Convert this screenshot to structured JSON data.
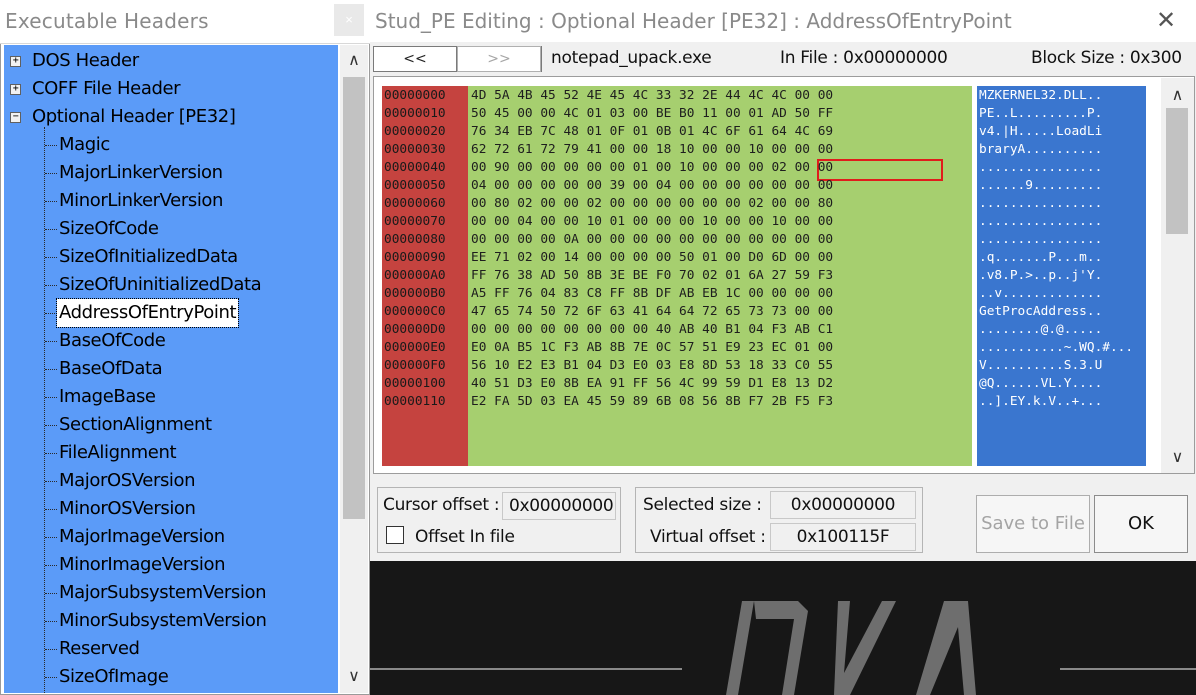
{
  "left_window": {
    "title": "Executable Headers",
    "close_label": "×",
    "tree": [
      {
        "label": "DOS Header",
        "level": 0,
        "expander": "+"
      },
      {
        "label": "COFF File Header",
        "level": 0,
        "expander": "+"
      },
      {
        "label": "Optional Header [PE32]",
        "level": 0,
        "expander": "−"
      },
      {
        "label": "Magic",
        "level": 1
      },
      {
        "label": "MajorLinkerVersion",
        "level": 1
      },
      {
        "label": "MinorLinkerVersion",
        "level": 1
      },
      {
        "label": "SizeOfCode",
        "level": 1
      },
      {
        "label": "SizeOfInitializedData",
        "level": 1
      },
      {
        "label": "SizeOfUninitializedData",
        "level": 1
      },
      {
        "label": "AddressOfEntryPoint",
        "level": 1,
        "selected": true
      },
      {
        "label": "BaseOfCode",
        "level": 1
      },
      {
        "label": "BaseOfData",
        "level": 1
      },
      {
        "label": "ImageBase",
        "level": 1
      },
      {
        "label": "SectionAlignment",
        "level": 1
      },
      {
        "label": "FileAlignment",
        "level": 1
      },
      {
        "label": "MajorOSVersion",
        "level": 1
      },
      {
        "label": "MinorOSVersion",
        "level": 1
      },
      {
        "label": "MajorImageVersion",
        "level": 1
      },
      {
        "label": "MinorImageVersion",
        "level": 1
      },
      {
        "label": "MajorSubsystemVersion",
        "level": 1
      },
      {
        "label": "MinorSubsystemVersion",
        "level": 1
      },
      {
        "label": "Reserved",
        "level": 1
      },
      {
        "label": "SizeOfImage",
        "level": 1
      }
    ],
    "scroll": {
      "up": "∧",
      "down": "∨"
    }
  },
  "right_window": {
    "title": "Stud_PE Editing : Optional Header [PE32] : AddressOfEntryPoint",
    "close_label": "✕",
    "toolbar": {
      "prev_label": "<<",
      "next_label": ">>",
      "file_name": "notepad_upack.exe",
      "in_file": "In File : 0x00000000",
      "block_size": "Block Size : 0x300"
    },
    "hex": {
      "addresses": [
        "00000000",
        "00000010",
        "00000020",
        "00000030",
        "00000040",
        "00000050",
        "00000060",
        "00000070",
        "00000080",
        "00000090",
        "000000A0",
        "000000B0",
        "000000C0",
        "000000D0",
        "000000E0",
        "000000F0",
        "00000100",
        "00000110"
      ],
      "bytes": [
        "4D 5A 4B 45 52 4E 45 4C 33 32 2E 44 4C 4C 00 00",
        "50 45 00 00 4C 01 03 00 BE B0 11 00 01 AD 50 FF",
        "76 34 EB 7C 48 01 0F 01 0B 01 4C 6F 61 64 4C 69",
        "62 72 61 72 79 41 00 00 18 10 00 00 10 00 00 00",
        "00 90 00 00 00 00 00 01 00 10 00 00 00 02 00 00",
        "04 00 00 00 00 00 39 00 04 00 00 00 00 00 00 00",
        "00 80 02 00 00 02 00 00 00 00 00 00 02 00 00 80",
        "00 00 04 00 00 10 01 00 00 00 10 00 00 10 00 00",
        "00 00 00 00 0A 00 00 00 00 00 00 00 00 00 00 00",
        "EE 71 02 00 14 00 00 00 00 50 01 00 D0 6D 00 00",
        "FF 76 38 AD 50 8B 3E BE F0 70 02 01 6A 27 59 F3",
        "A5 FF 76 04 83 C8 FF 8B DF AB EB 1C 00 00 00 00",
        "47 65 74 50 72 6F 63 41 64 64 72 65 73 73 00 00",
        "00 00 00 00 00 00 00 00 40 AB 40 B1 04 F3 AB C1",
        "E0 0A B5 1C F3 AB 8B 7E 0C 57 51 E9 23 EC 01 00",
        "56 10 E2 E3 B1 04 D3 E0 03 E8 8D 53 18 33 C0 55",
        "40 51 D3 E0 8B EA 91 FF 56 4C 99 59 D1 E8 13 D2",
        "E2 FA 5D 03 EA 45 59 89 6B 08 56 8B F7 2B F5 F3"
      ],
      "ascii": [
        "MZKERNEL32.DLL..",
        "PE..L.........P.",
        "v4.|H.....LoadLi",
        "braryA..........",
        "................",
        "......9.........",
        "................",
        "................",
        "................",
        ".q.......P...m..",
        ".v8.P.>..p..j'Y.",
        "..v.............",
        "GetProcAddress..",
        "........@.@.....",
        "...........~.WQ.#...",
        "V..........S.3.U",
        "@Q......VL.Y....",
        "..].EY.k.V..+..."
      ],
      "highlighted_bytes": "18 10 00 00",
      "scroll": {
        "up": "∧",
        "down": "∨"
      }
    },
    "cursor_panel": {
      "cursor_offset_label": "Cursor offset :",
      "cursor_offset_value": "0x00000000",
      "offset_in_file_label": "Offset In file",
      "offset_in_file_checked": false
    },
    "selection_panel": {
      "selected_size_label": "Selected size :",
      "selected_size_value": "0x00000000",
      "virtual_offset_label": "Virtual offset :",
      "virtual_offset_value": "0x100115F"
    },
    "buttons": {
      "save_label": "Save to File",
      "ok_label": "OK"
    }
  },
  "colors": {
    "tree_bg": "#5b9bf8",
    "hex_address": "#c5433f",
    "hex_bytes": "#a6cf6f",
    "hex_ascii": "#3a76cf",
    "highlight_border": "#e01c1c"
  }
}
